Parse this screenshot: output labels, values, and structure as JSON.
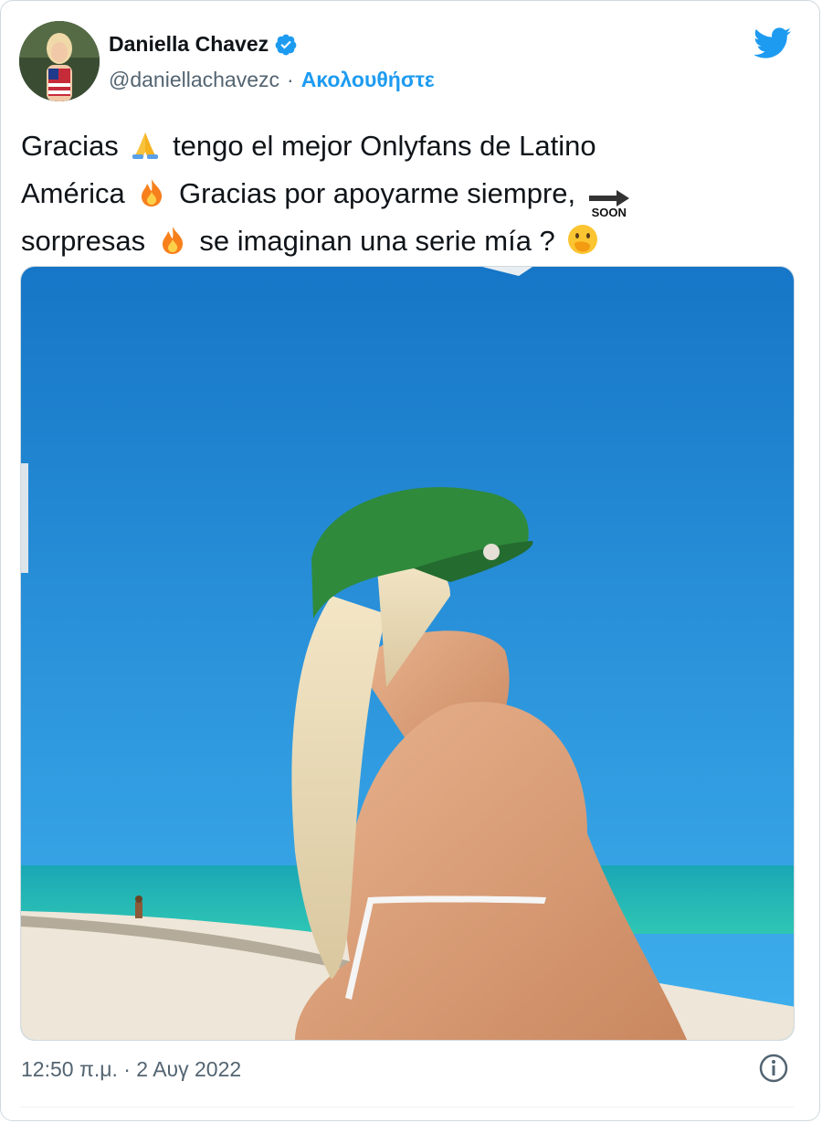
{
  "tweet": {
    "author_name": "Daniella Chavez",
    "handle": "@daniellachavezc",
    "separator": "·",
    "follow_label": "Ακολουθήστε",
    "text_lines": [
      [
        "Gracias",
        "tengo el mejor Onlyfans de Latino"
      ],
      [
        "América",
        "Gracias por apoyarme siempre,"
      ],
      [
        "sorpresas",
        "se imaginan una serie mía ?"
      ]
    ],
    "soon_label": "SOON",
    "timestamp": "12:50 π.μ. · 2 Αυγ 2022",
    "emojis": [
      "folded-hands",
      "fire",
      "soon-arrow",
      "fire",
      "face-with-hand-over-mouth"
    ]
  },
  "colors": {
    "accent": "#1d9bf0",
    "text": "#0f1419",
    "secondary": "#536471",
    "sky": "#1e8fd8",
    "sea": "#1fb5b0",
    "sand": "#efe8dc",
    "cap": "#2f8a3c"
  },
  "icons": {
    "verified": "verified-badge-icon",
    "brand": "twitter-bird-icon",
    "info": "info-icon"
  }
}
